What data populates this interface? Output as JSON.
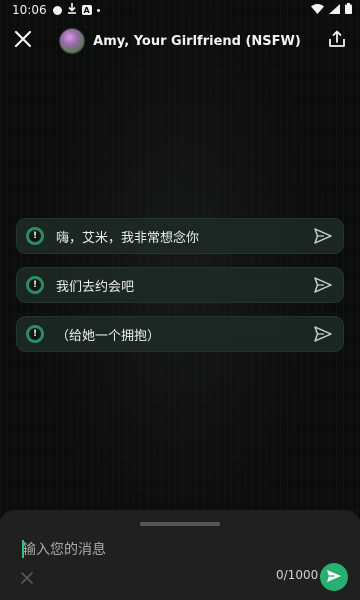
{
  "status_bar": {
    "time": "10:06",
    "left_icons": [
      "notification-dot-icon",
      "download-icon",
      "app-a-icon",
      "dot-icon"
    ],
    "right_icons": [
      "wifi-icon",
      "signal-icon",
      "battery-icon"
    ]
  },
  "header": {
    "title": "Amy, Your Girlfriend (NSFW)",
    "close_icon": "close-icon",
    "share_icon": "share-icon"
  },
  "suggestions": [
    {
      "text": "嗨，艾米，我非常想念你"
    },
    {
      "text": "我们去约会吧"
    },
    {
      "text": "（给她一个拥抱）"
    }
  ],
  "composer": {
    "placeholder": "输入您的消息",
    "value": "",
    "counter": "0/1000"
  },
  "colors": {
    "accent": "#27b06f",
    "suggestion_bg": "#1c2a24",
    "panel_bg": "#1f2020"
  }
}
